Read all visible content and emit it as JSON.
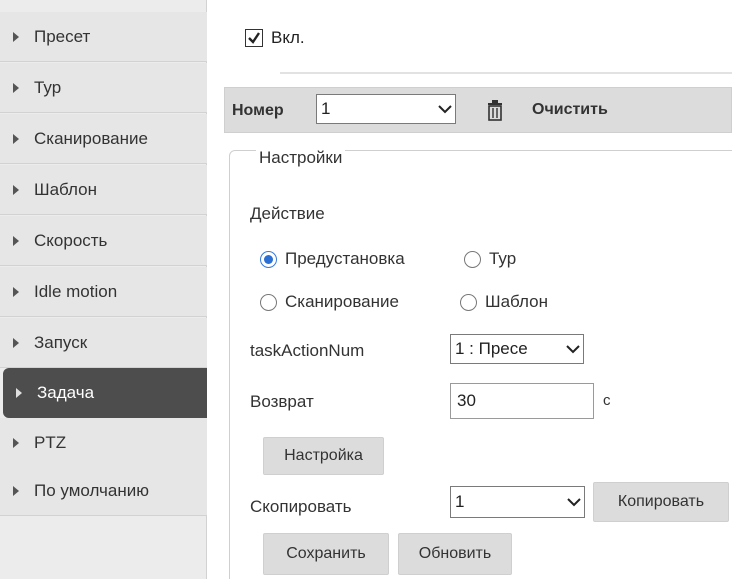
{
  "sidebar": {
    "items": [
      {
        "label": "Пресет"
      },
      {
        "label": "Тур"
      },
      {
        "label": "Сканирование"
      },
      {
        "label": "Шаблон"
      },
      {
        "label": "Скорость"
      },
      {
        "label": "Idle motion"
      },
      {
        "label": "Запуск"
      },
      {
        "label": "Задача",
        "active": true
      },
      {
        "label": "PTZ"
      },
      {
        "label": "По умолчанию"
      }
    ]
  },
  "enable": {
    "label": "Вкл.",
    "checked": true
  },
  "toolbar": {
    "number_label": "Номер",
    "number_value": "1",
    "trash_icon": "trash-icon",
    "clear_label": "Очистить"
  },
  "settings": {
    "legend": "Настройки",
    "action_label": "Действие",
    "radios": {
      "preset": "Предустановка",
      "tour": "Тур",
      "scan": "Сканирование",
      "pattern": "Шаблон",
      "selected": "preset"
    },
    "task_action_num_label": "taskActionNum",
    "task_action_num_value": "1 : Пресе",
    "return_label": "Возврат",
    "return_value": "30",
    "return_unit": "с",
    "setup_button": "Настройка",
    "copy_label": "Скопировать",
    "copy_value": "1",
    "copy_button": "Копировать",
    "save_button": "Сохранить",
    "refresh_button": "Обновить"
  },
  "colors": {
    "sidebar_bg": "#e6e6e6",
    "sidebar_active": "#4d4d4d",
    "toolbar_bg": "#dcdcdc",
    "radio_accent": "#2a6fd1"
  }
}
